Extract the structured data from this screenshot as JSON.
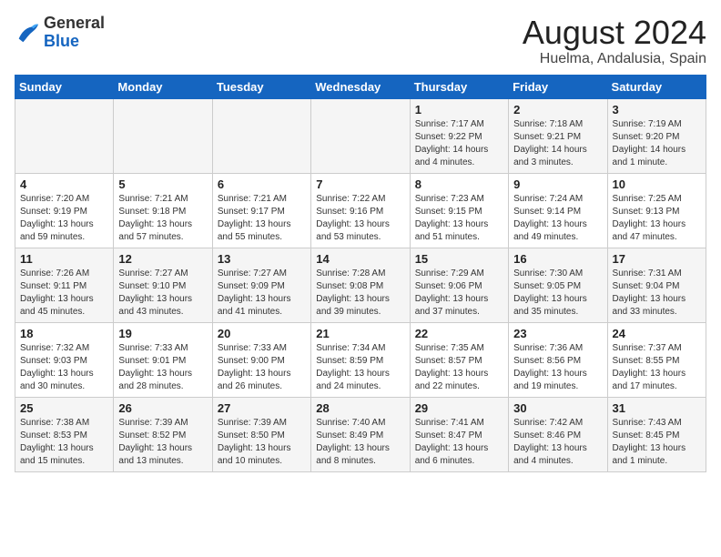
{
  "logo": {
    "general": "General",
    "blue": "Blue"
  },
  "title": "August 2024",
  "subtitle": "Huelma, Andalusia, Spain",
  "headers": [
    "Sunday",
    "Monday",
    "Tuesday",
    "Wednesday",
    "Thursday",
    "Friday",
    "Saturday"
  ],
  "weeks": [
    [
      {
        "day": "",
        "info": ""
      },
      {
        "day": "",
        "info": ""
      },
      {
        "day": "",
        "info": ""
      },
      {
        "day": "",
        "info": ""
      },
      {
        "day": "1",
        "info": "Sunrise: 7:17 AM\nSunset: 9:22 PM\nDaylight: 14 hours\nand 4 minutes."
      },
      {
        "day": "2",
        "info": "Sunrise: 7:18 AM\nSunset: 9:21 PM\nDaylight: 14 hours\nand 3 minutes."
      },
      {
        "day": "3",
        "info": "Sunrise: 7:19 AM\nSunset: 9:20 PM\nDaylight: 14 hours\nand 1 minute."
      }
    ],
    [
      {
        "day": "4",
        "info": "Sunrise: 7:20 AM\nSunset: 9:19 PM\nDaylight: 13 hours\nand 59 minutes."
      },
      {
        "day": "5",
        "info": "Sunrise: 7:21 AM\nSunset: 9:18 PM\nDaylight: 13 hours\nand 57 minutes."
      },
      {
        "day": "6",
        "info": "Sunrise: 7:21 AM\nSunset: 9:17 PM\nDaylight: 13 hours\nand 55 minutes."
      },
      {
        "day": "7",
        "info": "Sunrise: 7:22 AM\nSunset: 9:16 PM\nDaylight: 13 hours\nand 53 minutes."
      },
      {
        "day": "8",
        "info": "Sunrise: 7:23 AM\nSunset: 9:15 PM\nDaylight: 13 hours\nand 51 minutes."
      },
      {
        "day": "9",
        "info": "Sunrise: 7:24 AM\nSunset: 9:14 PM\nDaylight: 13 hours\nand 49 minutes."
      },
      {
        "day": "10",
        "info": "Sunrise: 7:25 AM\nSunset: 9:13 PM\nDaylight: 13 hours\nand 47 minutes."
      }
    ],
    [
      {
        "day": "11",
        "info": "Sunrise: 7:26 AM\nSunset: 9:11 PM\nDaylight: 13 hours\nand 45 minutes."
      },
      {
        "day": "12",
        "info": "Sunrise: 7:27 AM\nSunset: 9:10 PM\nDaylight: 13 hours\nand 43 minutes."
      },
      {
        "day": "13",
        "info": "Sunrise: 7:27 AM\nSunset: 9:09 PM\nDaylight: 13 hours\nand 41 minutes."
      },
      {
        "day": "14",
        "info": "Sunrise: 7:28 AM\nSunset: 9:08 PM\nDaylight: 13 hours\nand 39 minutes."
      },
      {
        "day": "15",
        "info": "Sunrise: 7:29 AM\nSunset: 9:06 PM\nDaylight: 13 hours\nand 37 minutes."
      },
      {
        "day": "16",
        "info": "Sunrise: 7:30 AM\nSunset: 9:05 PM\nDaylight: 13 hours\nand 35 minutes."
      },
      {
        "day": "17",
        "info": "Sunrise: 7:31 AM\nSunset: 9:04 PM\nDaylight: 13 hours\nand 33 minutes."
      }
    ],
    [
      {
        "day": "18",
        "info": "Sunrise: 7:32 AM\nSunset: 9:03 PM\nDaylight: 13 hours\nand 30 minutes."
      },
      {
        "day": "19",
        "info": "Sunrise: 7:33 AM\nSunset: 9:01 PM\nDaylight: 13 hours\nand 28 minutes."
      },
      {
        "day": "20",
        "info": "Sunrise: 7:33 AM\nSunset: 9:00 PM\nDaylight: 13 hours\nand 26 minutes."
      },
      {
        "day": "21",
        "info": "Sunrise: 7:34 AM\nSunset: 8:59 PM\nDaylight: 13 hours\nand 24 minutes."
      },
      {
        "day": "22",
        "info": "Sunrise: 7:35 AM\nSunset: 8:57 PM\nDaylight: 13 hours\nand 22 minutes."
      },
      {
        "day": "23",
        "info": "Sunrise: 7:36 AM\nSunset: 8:56 PM\nDaylight: 13 hours\nand 19 minutes."
      },
      {
        "day": "24",
        "info": "Sunrise: 7:37 AM\nSunset: 8:55 PM\nDaylight: 13 hours\nand 17 minutes."
      }
    ],
    [
      {
        "day": "25",
        "info": "Sunrise: 7:38 AM\nSunset: 8:53 PM\nDaylight: 13 hours\nand 15 minutes."
      },
      {
        "day": "26",
        "info": "Sunrise: 7:39 AM\nSunset: 8:52 PM\nDaylight: 13 hours\nand 13 minutes."
      },
      {
        "day": "27",
        "info": "Sunrise: 7:39 AM\nSunset: 8:50 PM\nDaylight: 13 hours\nand 10 minutes."
      },
      {
        "day": "28",
        "info": "Sunrise: 7:40 AM\nSunset: 8:49 PM\nDaylight: 13 hours\nand 8 minutes."
      },
      {
        "day": "29",
        "info": "Sunrise: 7:41 AM\nSunset: 8:47 PM\nDaylight: 13 hours\nand 6 minutes."
      },
      {
        "day": "30",
        "info": "Sunrise: 7:42 AM\nSunset: 8:46 PM\nDaylight: 13 hours\nand 4 minutes."
      },
      {
        "day": "31",
        "info": "Sunrise: 7:43 AM\nSunset: 8:45 PM\nDaylight: 13 hours\nand 1 minute."
      }
    ]
  ]
}
